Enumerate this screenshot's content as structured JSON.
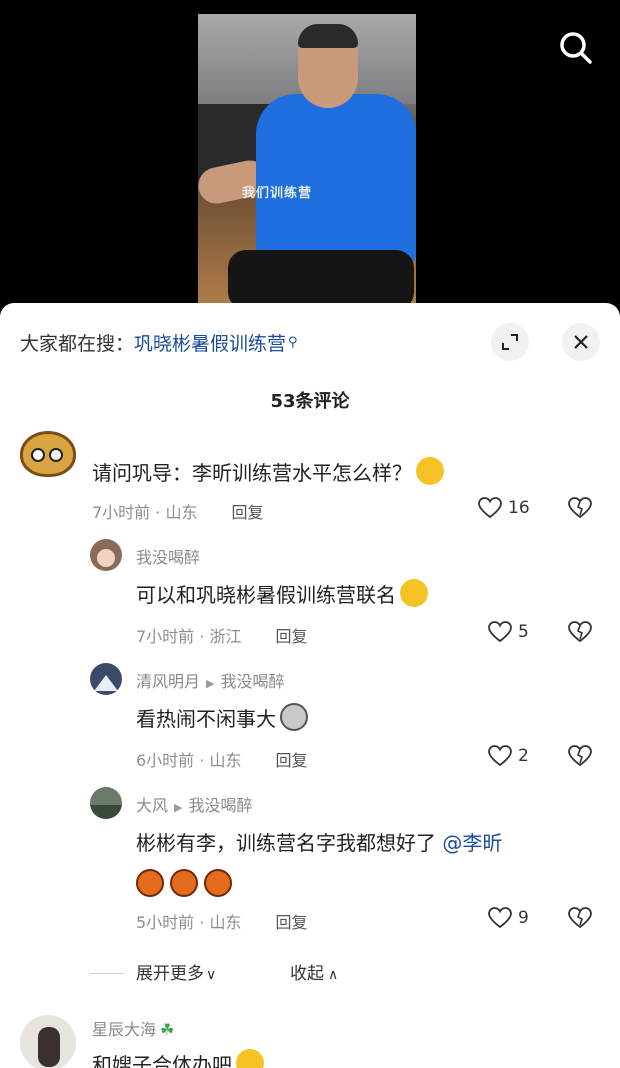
{
  "video": {
    "caption": "我们训练营"
  },
  "sheet": {
    "suggest_prefix": "大家都在搜：",
    "suggest_keyword": "巩晓彬暑假训练营",
    "comment_count": "53条评论"
  },
  "comments": [
    {
      "user": "",
      "text": "请问巩导：李昕训练营水平怎么样？",
      "time": "7小时前 · 山东",
      "reply": "回复",
      "likes": "16"
    },
    {
      "user": "我没喝醉",
      "text": "可以和巩晓彬暑假训练营联名",
      "time": "7小时前 · 浙江",
      "reply": "回复",
      "likes": "5"
    },
    {
      "user": "清风明月",
      "reply_to": "我没喝醉",
      "text": "看热闹不闲事大",
      "time": "6小时前 · 山东",
      "reply": "回复",
      "likes": "2"
    },
    {
      "user": "大风",
      "reply_to": "我没喝醉",
      "text": "彬彬有李，训练营名字我都想好了",
      "mention": "@李昕",
      "time": "5小时前 · 山东",
      "reply": "回复",
      "likes": "9"
    },
    {
      "user": "星辰大海",
      "text": "和嫂子合体办吧"
    }
  ],
  "expand_label": "展开更多",
  "collapse_label": "收起",
  "colors": {
    "link": "#1b4c9a",
    "sheet": "#ffffff"
  }
}
